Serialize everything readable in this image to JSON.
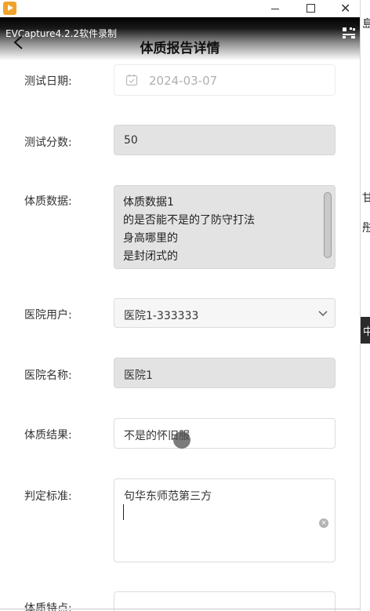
{
  "window": {
    "close_glyph": "✕",
    "icons": {
      "app": "evcapture-play-icon",
      "minimize": "minimize-icon",
      "maximize": "maximize-icon",
      "close": "close-icon"
    }
  },
  "header": {
    "overlay_label": "EVCapture4.2.2软件录制",
    "title": "体质报告详情",
    "icons": {
      "back": "chevron-left-icon",
      "menu": "qr-grid-icon"
    }
  },
  "form": {
    "test_date": {
      "label": "测试日期:",
      "value": "2024-03-07",
      "icon": "calendar-icon"
    },
    "test_score": {
      "label": "测试分数:",
      "value": "50"
    },
    "body_data": {
      "label": "体质数据:",
      "lines": [
        "体质数据1",
        "的是否能不是的了防守打法",
        "身高哪里的",
        "是封闭式的"
      ]
    },
    "hospital_user": {
      "label": "医院用户:",
      "value": "医院1-333333",
      "icon": "chevron-down-icon"
    },
    "hospital_name": {
      "label": "医院名称:",
      "value": "医院1"
    },
    "body_result": {
      "label": "体质结果:",
      "value": "不是的怀旧服"
    },
    "criteria": {
      "label": "判定标准:",
      "value": "句华东师范第三方",
      "icon": "clear-icon",
      "clear_glyph": "×"
    },
    "body_traits": {
      "label": "体质特点:",
      "value": ""
    }
  },
  "side_strip": {
    "text1": "島",
    "text2": "甘",
    "text3": "彤",
    "bar_text": "中"
  },
  "colors": {
    "disabled_bg": "#e3e3e3",
    "header_top": "#000000",
    "accent_icon": "#f0a229"
  }
}
